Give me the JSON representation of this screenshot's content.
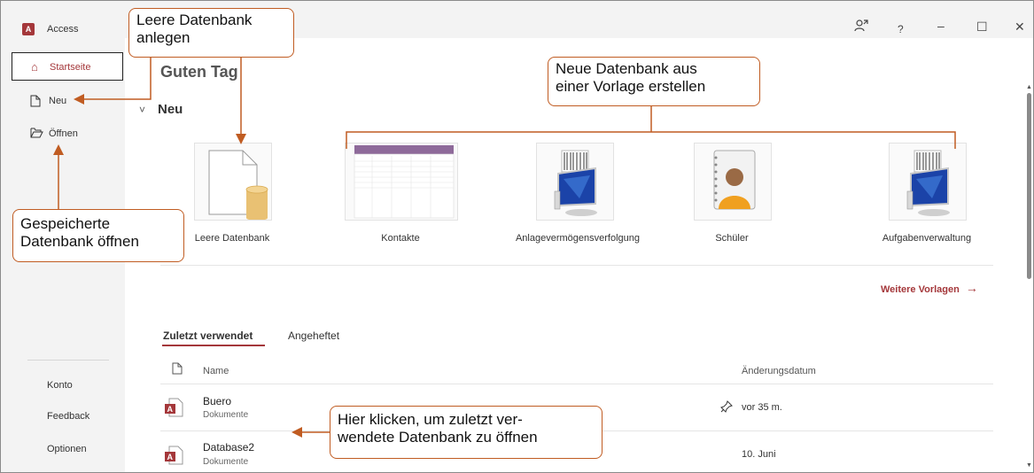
{
  "app": {
    "logo": "A",
    "name": "Access"
  },
  "titlebar": {
    "share_icon": "person-share-icon",
    "help": "?",
    "minimize": "–",
    "maximize": "☐",
    "close": "✕"
  },
  "sidebar": {
    "items": [
      {
        "label": "Startseite",
        "icon": "home-icon",
        "glyph": "⌂"
      },
      {
        "label": "Neu",
        "icon": "new-document-icon",
        "glyph": "🗋"
      },
      {
        "label": "Öffnen",
        "icon": "folder-open-icon",
        "glyph": "🗀"
      }
    ],
    "bottom": [
      "Konto",
      "Feedback",
      "Optionen"
    ]
  },
  "main": {
    "greeting": "Guten Tag",
    "new_section": {
      "chevron": "˅",
      "title": "Neu"
    },
    "templates": [
      {
        "label": "Leere Datenbank"
      },
      {
        "label": "Kontakte"
      },
      {
        "label": "Anlagevermögensverfolgung"
      },
      {
        "label": "Schüler"
      },
      {
        "label": "Aufgabenverwaltung"
      }
    ],
    "more_templates": "Weitere Vorlagen",
    "more_arrow": "→",
    "tabs": [
      "Zuletzt verwendet",
      "Angeheftet"
    ],
    "columns": {
      "name": "Name",
      "date": "Änderungsdatum"
    },
    "files": [
      {
        "name": "Buero",
        "location": "Dokumente",
        "date": "vor 35 m.",
        "pinned": true
      },
      {
        "name": "Database2",
        "location": "Dokumente",
        "date": "10. Juni",
        "pinned": false
      }
    ]
  },
  "callouts": {
    "leere": [
      "Leere Datenbank",
      "anlegen"
    ],
    "vorlage": [
      "Neue Datenbank aus",
      "einer Vorlage erstellen"
    ],
    "gespeichert": [
      "Gespeicherte",
      "Datenbank öffnen"
    ],
    "zuletzt": [
      "Hier klicken, um zuletzt ver-",
      "wendete Datenbank zu öffnen"
    ]
  },
  "colors": {
    "accent": "#a4373a",
    "callout_border": "#c05c22",
    "sidebar_bg": "#f3f3f3"
  }
}
